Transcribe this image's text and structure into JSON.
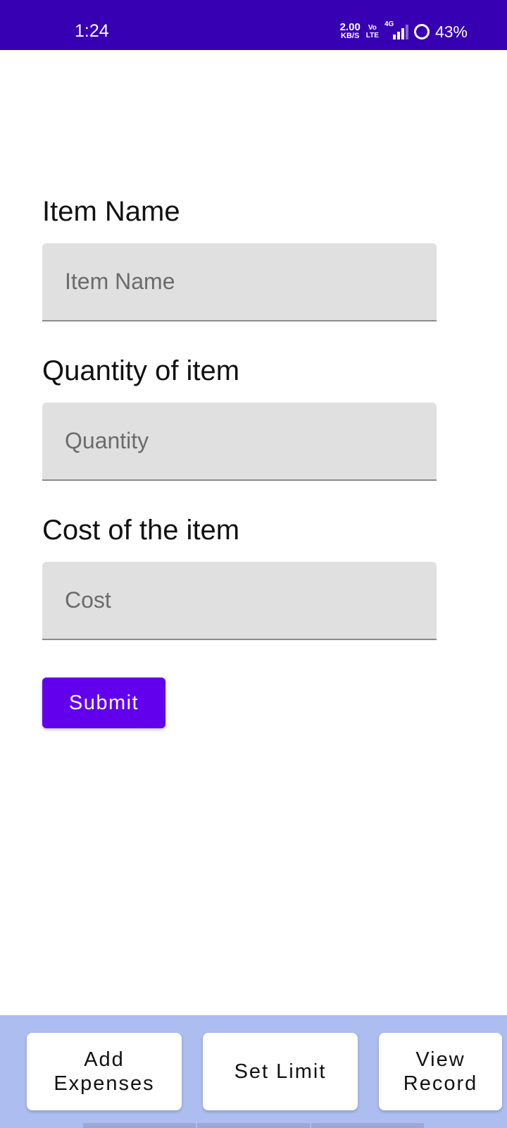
{
  "status_bar": {
    "time": "1:24",
    "net_speed_value": "2.00",
    "net_speed_unit": "KB/S",
    "volte_top": "Vo",
    "volte_bottom": "LTE",
    "network_type": "4G",
    "battery_percent": "43%",
    "background_color": "#3700b3"
  },
  "form": {
    "item_name": {
      "label": "Item Name",
      "placeholder": "Item Name",
      "value": ""
    },
    "quantity": {
      "label": "Quantity of item",
      "placeholder": "Quantity",
      "value": ""
    },
    "cost": {
      "label": "Cost of the item",
      "placeholder": "Cost",
      "value": ""
    },
    "submit_label": "Submit",
    "accent_color": "#6200ee"
  },
  "bottom_nav": {
    "add_expenses": "Add\nExpenses",
    "set_limit": "Set Limit",
    "view_record": "View\nRecord",
    "background_color": "#adbdf0"
  },
  "icons": [
    "signal-icon",
    "battery-icon"
  ]
}
